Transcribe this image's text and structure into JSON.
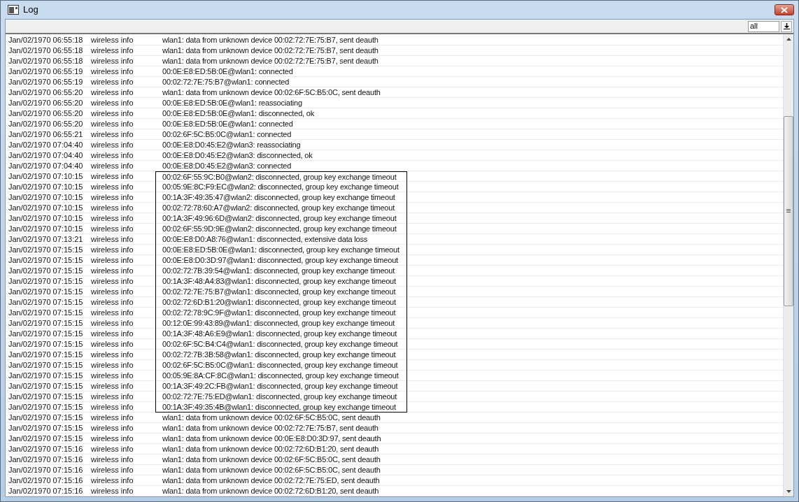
{
  "window": {
    "title": "Log"
  },
  "filter": {
    "value": "all"
  },
  "rows": [
    {
      "time": "Jan/02/1970 06:55:18",
      "topics": "wireless info",
      "message": "wlan1: data from unknown device 00:02:72:7E:75:B7, sent deauth",
      "boxed": false
    },
    {
      "time": "Jan/02/1970 06:55:18",
      "topics": "wireless info",
      "message": "wlan1: data from unknown device 00:02:72:7E:75:B7, sent deauth",
      "boxed": false
    },
    {
      "time": "Jan/02/1970 06:55:18",
      "topics": "wireless info",
      "message": "wlan1: data from unknown device 00:02:72:7E:75:B7, sent deauth",
      "boxed": false
    },
    {
      "time": "Jan/02/1970 06:55:19",
      "topics": "wireless info",
      "message": "00:0E:E8:ED:5B:0E@wlan1: connected",
      "boxed": false
    },
    {
      "time": "Jan/02/1970 06:55:19",
      "topics": "wireless info",
      "message": "00:02:72:7E:75:B7@wlan1: connected",
      "boxed": false
    },
    {
      "time": "Jan/02/1970 06:55:20",
      "topics": "wireless info",
      "message": "wlan1: data from unknown device 00:02:6F:5C:B5:0C, sent deauth",
      "boxed": false
    },
    {
      "time": "Jan/02/1970 06:55:20",
      "topics": "wireless info",
      "message": "00:0E:E8:ED:5B:0E@wlan1: reassociating",
      "boxed": false
    },
    {
      "time": "Jan/02/1970 06:55:20",
      "topics": "wireless info",
      "message": "00:0E:E8:ED:5B:0E@wlan1: disconnected, ok",
      "boxed": false
    },
    {
      "time": "Jan/02/1970 06:55:20",
      "topics": "wireless info",
      "message": "00:0E:E8:ED:5B:0E@wlan1: connected",
      "boxed": false
    },
    {
      "time": "Jan/02/1970 06:55:21",
      "topics": "wireless info",
      "message": "00:02:6F:5C:B5:0C@wlan1: connected",
      "boxed": false
    },
    {
      "time": "Jan/02/1970 07:04:40",
      "topics": "wireless info",
      "message": "00:0E:E8:D0:45:E2@wlan3: reassociating",
      "boxed": false
    },
    {
      "time": "Jan/02/1970 07:04:40",
      "topics": "wireless info",
      "message": "00:0E:E8:D0:45:E2@wlan3: disconnected, ok",
      "boxed": false
    },
    {
      "time": "Jan/02/1970 07:04:40",
      "topics": "wireless info",
      "message": "00:0E:E8:D0:45:E2@wlan3: connected",
      "boxed": false
    },
    {
      "time": "Jan/02/1970 07:10:15",
      "topics": "wireless info",
      "message": "00:02:6F:55:9C:B0@wlan2: disconnected, group key exchange timeout",
      "boxed": true
    },
    {
      "time": "Jan/02/1970 07:10:15",
      "topics": "wireless info",
      "message": "00:05:9E:8C:F9:EC@wlan2: disconnected, group key exchange timeout",
      "boxed": true
    },
    {
      "time": "Jan/02/1970 07:10:15",
      "topics": "wireless info",
      "message": "00:1A:3F:49:35:47@wlan2: disconnected, group key exchange timeout",
      "boxed": true
    },
    {
      "time": "Jan/02/1970 07:10:15",
      "topics": "wireless info",
      "message": "00:02:72:78:60:A7@wlan2: disconnected, group key exchange timeout",
      "boxed": true
    },
    {
      "time": "Jan/02/1970 07:10:15",
      "topics": "wireless info",
      "message": "00:1A:3F:49:96:6D@wlan2: disconnected, group key exchange timeout",
      "boxed": true
    },
    {
      "time": "Jan/02/1970 07:10:15",
      "topics": "wireless info",
      "message": "00:02:6F:55:9D:9E@wlan2: disconnected, group key exchange timeout",
      "boxed": true
    },
    {
      "time": "Jan/02/1970 07:13:21",
      "topics": "wireless info",
      "message": "00:0E:E8:D0:A8:76@wlan1: disconnected, extensive data loss",
      "boxed": true
    },
    {
      "time": "Jan/02/1970 07:15:15",
      "topics": "wireless info",
      "message": "00:0E:E8:ED:5B:0E@wlan1: disconnected, group key exchange timeout",
      "boxed": true
    },
    {
      "time": "Jan/02/1970 07:15:15",
      "topics": "wireless info",
      "message": "00:0E:E8:D0:3D:97@wlan1: disconnected, group key exchange timeout",
      "boxed": true
    },
    {
      "time": "Jan/02/1970 07:15:15",
      "topics": "wireless info",
      "message": "00:02:72:7B:39:54@wlan1: disconnected, group key exchange timeout",
      "boxed": true
    },
    {
      "time": "Jan/02/1970 07:15:15",
      "topics": "wireless info",
      "message": "00:1A:3F:48:A4:83@wlan1: disconnected, group key exchange timeout",
      "boxed": true
    },
    {
      "time": "Jan/02/1970 07:15:15",
      "topics": "wireless info",
      "message": "00:02:72:7E:75:B7@wlan1: disconnected, group key exchange timeout",
      "boxed": true
    },
    {
      "time": "Jan/02/1970 07:15:15",
      "topics": "wireless info",
      "message": "00:02:72:6D:B1:20@wlan1: disconnected, group key exchange timeout",
      "boxed": true
    },
    {
      "time": "Jan/02/1970 07:15:15",
      "topics": "wireless info",
      "message": "00:02:72:78:9C:9F@wlan1: disconnected, group key exchange timeout",
      "boxed": true
    },
    {
      "time": "Jan/02/1970 07:15:15",
      "topics": "wireless info",
      "message": "00:12:0E:99:43:89@wlan1: disconnected, group key exchange timeout",
      "boxed": true
    },
    {
      "time": "Jan/02/1970 07:15:15",
      "topics": "wireless info",
      "message": "00:1A:3F:48:A6:E9@wlan1: disconnected, group key exchange timeout",
      "boxed": true
    },
    {
      "time": "Jan/02/1970 07:15:15",
      "topics": "wireless info",
      "message": "00:02:6F:5C:B4:C4@wlan1: disconnected, group key exchange timeout",
      "boxed": true
    },
    {
      "time": "Jan/02/1970 07:15:15",
      "topics": "wireless info",
      "message": "00:02:72:7B:3B:58@wlan1: disconnected, group key exchange timeout",
      "boxed": true
    },
    {
      "time": "Jan/02/1970 07:15:15",
      "topics": "wireless info",
      "message": "00:02:6F:5C:B5:0C@wlan1: disconnected, group key exchange timeout",
      "boxed": true
    },
    {
      "time": "Jan/02/1970 07:15:15",
      "topics": "wireless info",
      "message": "00:05:9E:8A:CF:8C@wlan1: disconnected, group key exchange timeout",
      "boxed": true
    },
    {
      "time": "Jan/02/1970 07:15:15",
      "topics": "wireless info",
      "message": "00:1A:3F:49:2C:FB@wlan1: disconnected, group key exchange timeout",
      "boxed": true
    },
    {
      "time": "Jan/02/1970 07:15:15",
      "topics": "wireless info",
      "message": "00:02:72:7E:75:ED@wlan1: disconnected, group key exchange timeout",
      "boxed": true
    },
    {
      "time": "Jan/02/1970 07:15:15",
      "topics": "wireless info",
      "message": "00:1A:3F:49:35:4B@wlan1: disconnected, group key exchange timeout",
      "boxed": true
    },
    {
      "time": "Jan/02/1970 07:15:15",
      "topics": "wireless info",
      "message": "wlan1: data from unknown device 00:02:6F:5C:B5:0C, sent deauth",
      "boxed": false
    },
    {
      "time": "Jan/02/1970 07:15:15",
      "topics": "wireless info",
      "message": "wlan1: data from unknown device 00:02:72:7E:75:B7, sent deauth",
      "boxed": false
    },
    {
      "time": "Jan/02/1970 07:15:15",
      "topics": "wireless info",
      "message": "wlan1: data from unknown device 00:0E:E8:D0:3D:97, sent deauth",
      "boxed": false
    },
    {
      "time": "Jan/02/1970 07:15:16",
      "topics": "wireless info",
      "message": "wlan1: data from unknown device 00:02:72:6D:B1:20, sent deauth",
      "boxed": false
    },
    {
      "time": "Jan/02/1970 07:15:16",
      "topics": "wireless info",
      "message": "wlan1: data from unknown device 00:02:6F:5C:B5:0C, sent deauth",
      "boxed": false
    },
    {
      "time": "Jan/02/1970 07:15:16",
      "topics": "wireless info",
      "message": "wlan1: data from unknown device 00:02:6F:5C:B5:0C, sent deauth",
      "boxed": false
    },
    {
      "time": "Jan/02/1970 07:15:16",
      "topics": "wireless info",
      "message": "wlan1: data from unknown device 00:02:72:7E:75:ED, sent deauth",
      "boxed": false
    },
    {
      "time": "Jan/02/1970 07:15:16",
      "topics": "wireless info",
      "message": "wlan1: data from unknown device 00:02:72:6D:B1:20, sent deauth",
      "boxed": false
    }
  ]
}
